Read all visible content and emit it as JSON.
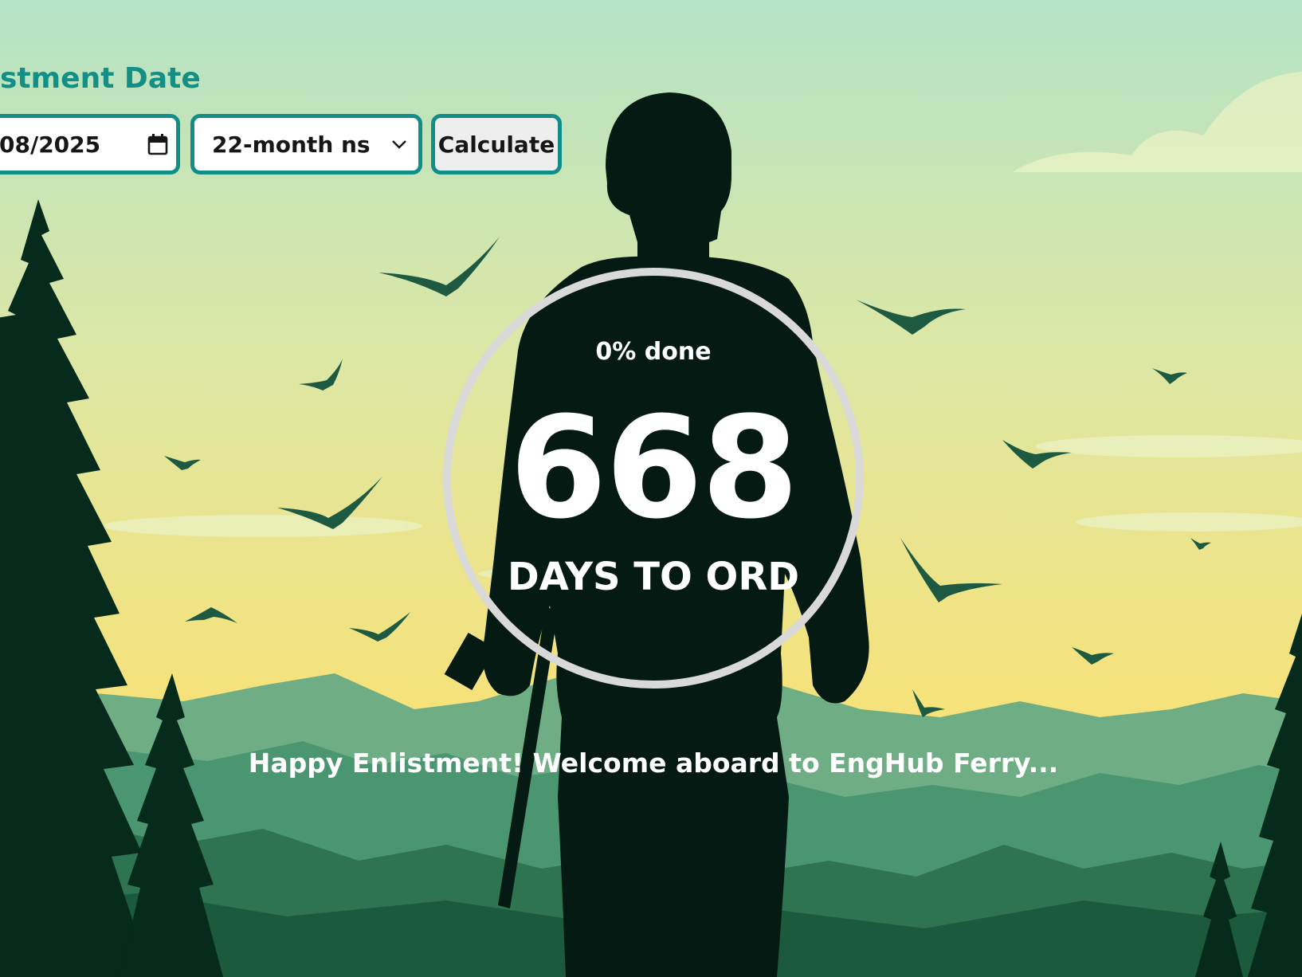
{
  "form": {
    "label": "stment Date",
    "date_value": "08/2025",
    "service_selected": "22-month ns",
    "calculate_label": "Calculate"
  },
  "progress": {
    "percent_done": 0,
    "percent_label": "0% done",
    "days": "668",
    "days_label": "DAYS TO ORD"
  },
  "message": "Happy Enlistment! Welcome aboard to EngHub Ferry...",
  "colors": {
    "accent": "#128d88",
    "sky_top": "#b4e3c6",
    "sky_bottom": "#f5e07a",
    "silhouette": "#041a12",
    "ring": "#d9d9d9",
    "text_light": "#ffffff"
  }
}
